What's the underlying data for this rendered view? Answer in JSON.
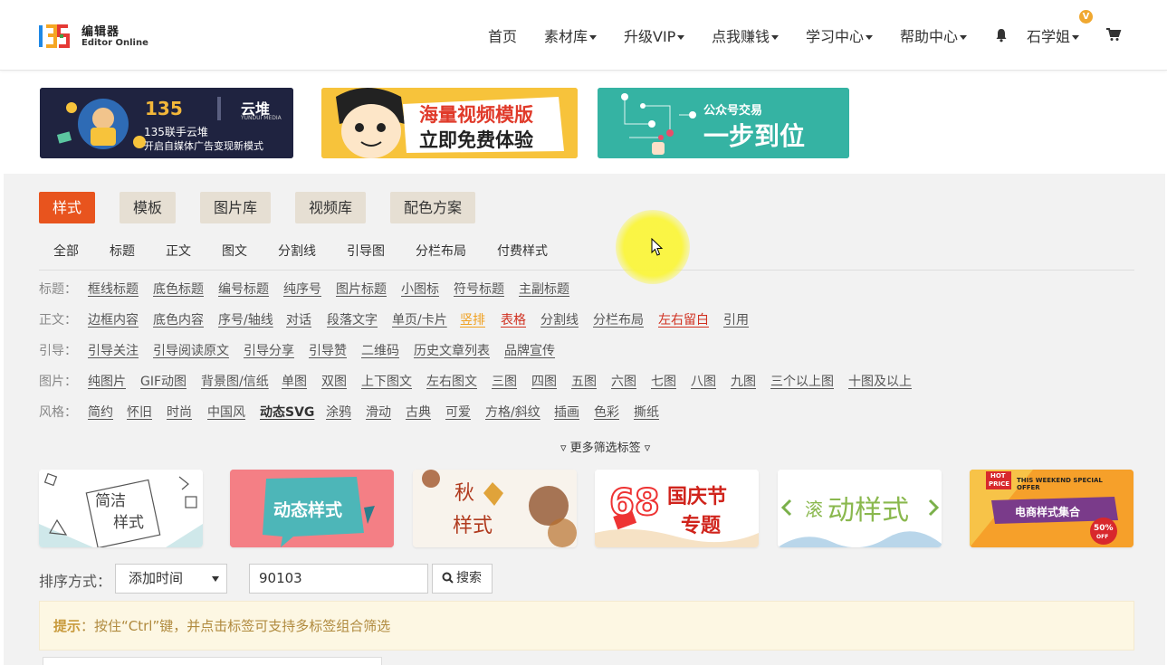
{
  "header": {
    "logo_cn": "编辑器",
    "logo_en": "Editor Online",
    "nav": [
      {
        "label": "首页",
        "dropdown": false
      },
      {
        "label": "素材库",
        "dropdown": true
      },
      {
        "label": "升级VIP",
        "dropdown": true
      },
      {
        "label": "点我赚钱",
        "dropdown": true
      },
      {
        "label": "学习中心",
        "dropdown": true
      },
      {
        "label": "帮助中心",
        "dropdown": true
      }
    ],
    "user": "石学姐",
    "vip_badge": "V"
  },
  "banners": [
    {
      "line1": "135联手云堆",
      "line2": "开启自媒体广告变现新模式",
      "brand": "云堆",
      "brand_sub": "YUNDUI MEDIA"
    },
    {
      "line1": "海量视频模版",
      "line2": "立即免费体验"
    },
    {
      "line1": "公众号交易",
      "line2": "一步到位"
    }
  ],
  "tabs": [
    "样式",
    "模板",
    "图片库",
    "视频库",
    "配色方案"
  ],
  "active_tab": "样式",
  "subnav": [
    "全部",
    "标题",
    "正文",
    "图文",
    "分割线",
    "引导图",
    "分栏布局",
    "付费样式"
  ],
  "filters": [
    {
      "label": "标题：",
      "tags": [
        "框线标题",
        "底色标题",
        "编号标题",
        "纯序号",
        "图片标题",
        "小图标",
        "符号标题",
        "主副标题"
      ]
    },
    {
      "label": "正文：",
      "tags": [
        "边框内容",
        "底色内容",
        "序号/轴线",
        "对话",
        "段落文字",
        "单页/卡片",
        "竖排",
        "表格",
        "分割线",
        "分栏布局",
        "左右留白",
        "引用"
      ]
    },
    {
      "label": "引导：",
      "tags": [
        "引导关注",
        "引导阅读原文",
        "引导分享",
        "引导赞",
        "二维码",
        "历史文章列表",
        "品牌宣传"
      ]
    },
    {
      "label": "图片：",
      "tags": [
        "纯图片",
        "GIF动图",
        "背景图/信纸",
        "单图",
        "双图",
        "上下图文",
        "左右图文",
        "三图",
        "四图",
        "五图",
        "六图",
        "七图",
        "八图",
        "九图",
        "三个以上图",
        "十图及以上"
      ]
    },
    {
      "label": "风格：",
      "tags": [
        "简约",
        "怀旧",
        "时尚",
        "中国风",
        "动态SVG",
        "涂鸦",
        "滑动",
        "古典",
        "可爱",
        "方格/斜纹",
        "插画",
        "色彩",
        "撕纸"
      ]
    }
  ],
  "more_filters": "▿ 更多筛选标签 ▿",
  "thumbs": [
    {
      "text1": "简洁",
      "text2": "样式"
    },
    {
      "text1": "动态样式"
    },
    {
      "text1": "秋",
      "text2": "样式"
    },
    {
      "text1": "国庆节",
      "text2": "专题",
      "num": "68"
    },
    {
      "text1": "滚",
      "text2": "动样式"
    },
    {
      "text1": "HOT",
      "text2": "PRICE",
      "text3": "THIS WEEKEND SPECIAL OFFER",
      "text4": "电商样式集合",
      "text5": "50%",
      "text6": "OFF"
    }
  ],
  "sort": {
    "label": "排序方式：",
    "value": "添加时间"
  },
  "search": {
    "value": "90103",
    "button": "搜索"
  },
  "tip": {
    "prefix": "提示",
    "text": "：按住“Ctrl”键，并点击标签可支持多标签组合筛选"
  },
  "colors": {
    "accent": "#e8541e",
    "tab_bg": "#e6dfd3",
    "panel_bg": "#f2f2f2",
    "tip_bg": "#fdf7e3"
  }
}
